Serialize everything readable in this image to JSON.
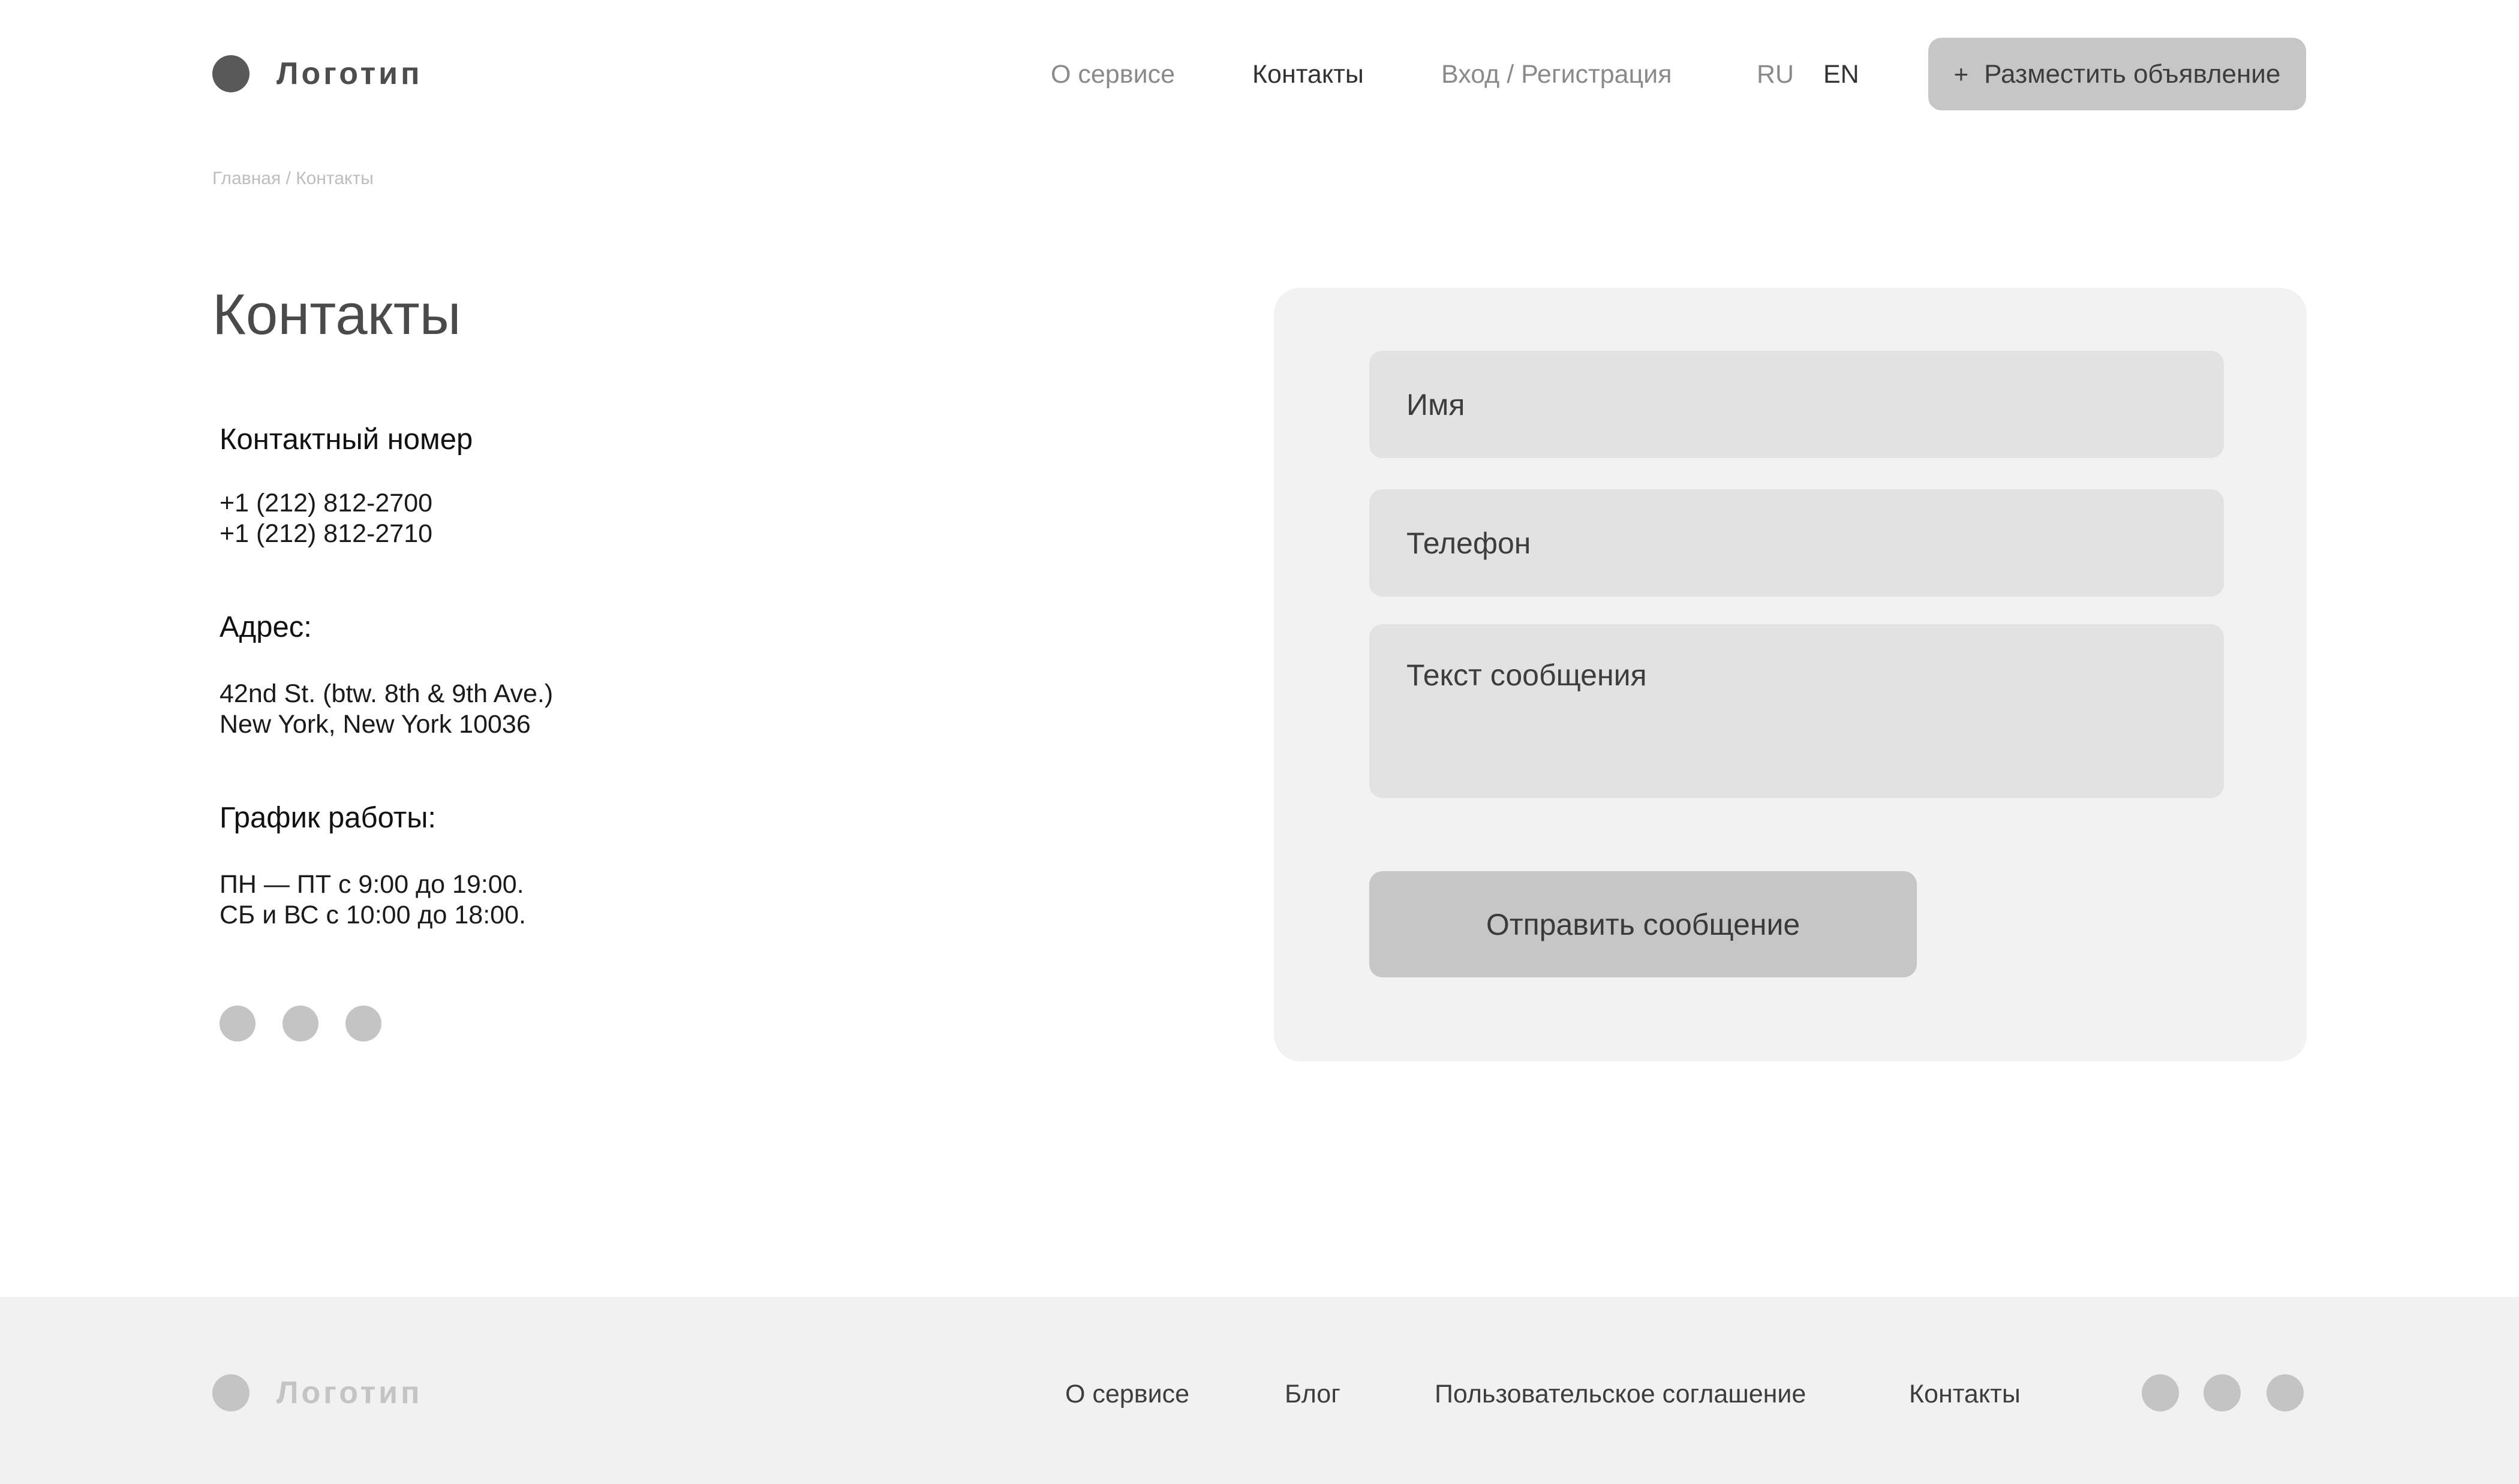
{
  "header": {
    "logo_text": "Логотип",
    "nav": {
      "about": "О сервисе",
      "contacts": "Контакты",
      "login": "Вход / Регистрация",
      "lang_ru": "RU",
      "lang_en": "EN"
    },
    "post_button": {
      "icon": "+",
      "label": "Разместить объявление"
    }
  },
  "breadcrumb": "Главная / Контакты",
  "page_title": "Контакты",
  "contact_info": {
    "phone_heading": "Контактный номер",
    "phones": [
      "+1 (212) 812-2700",
      "+1 (212) 812-2710"
    ],
    "address_heading": "Адрес:",
    "address_lines": [
      "42nd St. (btw. 8th & 9th Ave.)",
      "New York, New York 10036"
    ],
    "schedule_heading": "График работы:",
    "schedule_lines": [
      "ПН — ПТ с 9:00 до 19:00.",
      "СБ и ВС с 10:00 до 18:00."
    ]
  },
  "form": {
    "name_placeholder": "Имя",
    "phone_placeholder": "Телефон",
    "message_placeholder": "Текст сообщения",
    "submit_label": "Отправить сообщение"
  },
  "footer": {
    "logo_text": "Логотип",
    "links": {
      "about": "О сервисе",
      "blog": "Блог",
      "terms": "Пользовательское соглашение",
      "contacts": "Контакты"
    }
  },
  "colors": {
    "button_bg": "#c6c6c6",
    "panel_bg": "#f2f2f2",
    "field_bg": "#e2e2e2",
    "footer_bg": "#f1f1f1",
    "placeholder_circle": "#c4c4c4"
  }
}
